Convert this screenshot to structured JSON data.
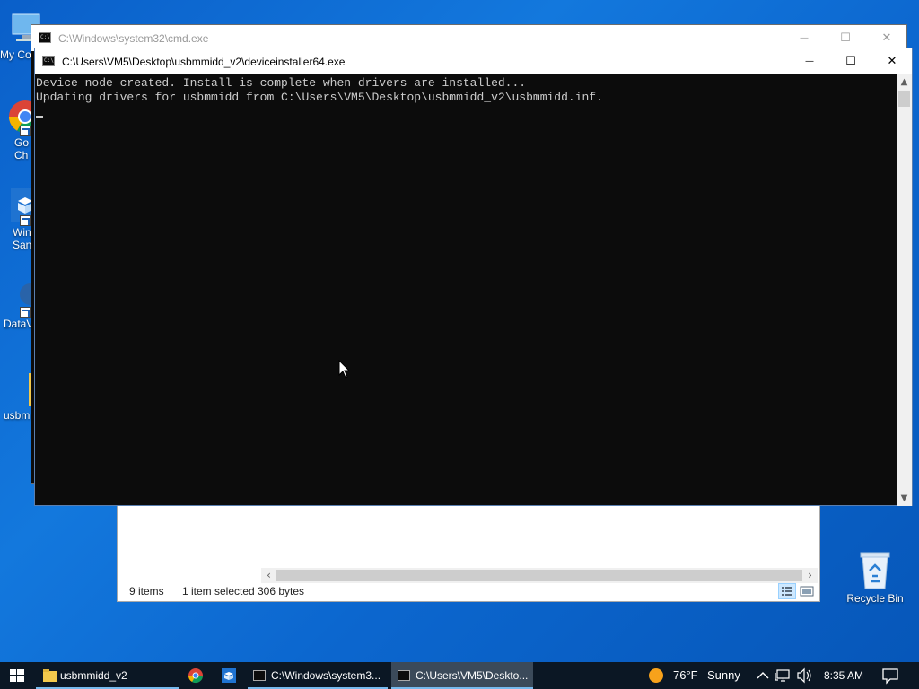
{
  "desktop": {
    "icons": [
      {
        "label": "My Co"
      },
      {
        "label": "Go\nCh"
      },
      {
        "label": "Win\nSan"
      },
      {
        "label": "DataV"
      },
      {
        "label": "usbm"
      }
    ],
    "recycle_bin": {
      "label": "Recycle Bin"
    }
  },
  "cmd_back": {
    "title": "C:\\Windows\\system32\\cmd.exe",
    "minimize": "—",
    "maximize": "☐",
    "close": "✕"
  },
  "cmd_front": {
    "title": "C:\\Users\\VM5\\Desktop\\usbmmidd_v2\\deviceinstaller64.exe",
    "minimize": "—",
    "maximize": "☐",
    "close": "✕",
    "console_lines": [
      "Device node created. Install is complete when drivers are installed...",
      "Updating drivers for usbmmidd from C:\\Users\\VM5\\Desktop\\usbmmidd_v2\\usbmmidd.inf."
    ]
  },
  "explorer": {
    "status_items": "9 items",
    "status_selected": "1 item selected",
    "status_size": "306 bytes"
  },
  "taskbar": {
    "tasks": [
      {
        "label": "usbmmidd_v2"
      },
      {
        "label": "C:\\Windows\\system3..."
      },
      {
        "label": "C:\\Users\\VM5\\Deskto..."
      }
    ],
    "weather_temp": "76°F",
    "weather_cond": "Sunny",
    "clock": "8:35 AM"
  },
  "colors": {
    "desktop": "#0a5fc9",
    "console_bg": "#0c0c0c",
    "console_text": "#cccccc",
    "taskbar": "#0b1724",
    "accent": "#76b9ed"
  }
}
